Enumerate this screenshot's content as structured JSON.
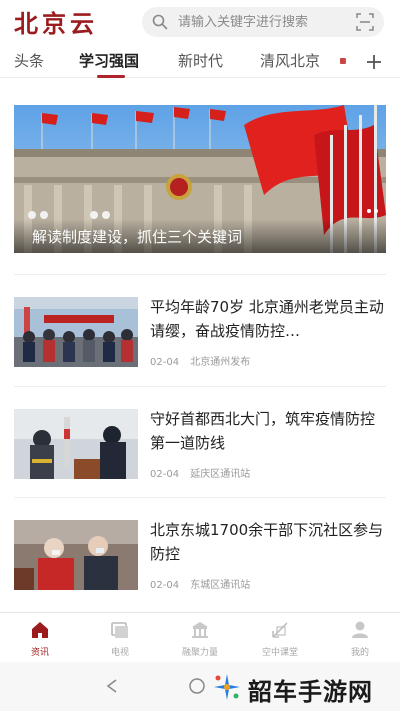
{
  "header": {
    "logo_text": "北京云",
    "search": {
      "placeholder": "请输入关键字进行搜索"
    }
  },
  "tabs": [
    {
      "label": "头条"
    },
    {
      "label": "学习强国",
      "active": true
    },
    {
      "label": "新时代"
    },
    {
      "label": "清风北京"
    }
  ],
  "banner": {
    "caption": "解读制度建设，抓住三个关键词"
  },
  "news": [
    {
      "title": "平均年龄70岁 北京通州老党员主动请缨，奋战疫情防控…",
      "date": "02-04",
      "source": "北京通州发布"
    },
    {
      "title": "守好首都西北大门，筑牢疫情防控第一道防线",
      "date": "02-04",
      "source": "延庆区通讯站"
    },
    {
      "title": "北京东城1700余干部下沉社区参与防控",
      "date": "02-04",
      "source": "东城区通讯站"
    }
  ],
  "bottom_nav": [
    {
      "label": "资讯",
      "icon": "home-icon",
      "active": true
    },
    {
      "label": "电视",
      "icon": "tv-icon"
    },
    {
      "label": "融聚力量",
      "icon": "temple-icon"
    },
    {
      "label": "空中课堂",
      "icon": "classroom-icon"
    },
    {
      "label": "我的",
      "icon": "user-icon"
    }
  ],
  "watermark": {
    "text": "韶车手游网"
  },
  "colors": {
    "brand": "#9b1c1f",
    "accent": "#b0232a"
  }
}
